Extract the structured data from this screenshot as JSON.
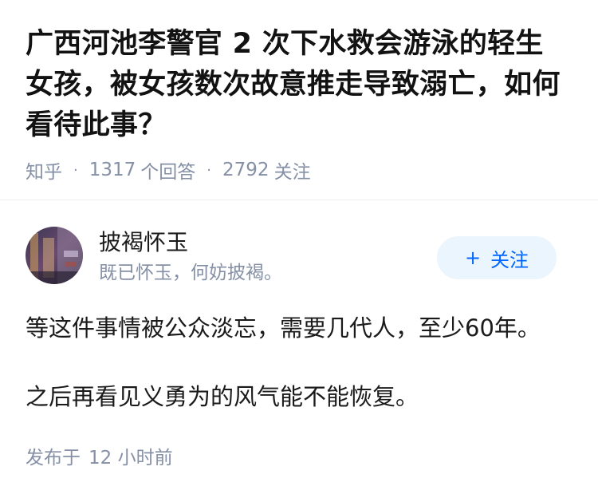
{
  "question": {
    "title": "广西河池李警官 2 次下水救会游泳的轻生女孩，被女孩数次故意推走导致溺亡，如何看待此事？",
    "source": "知乎",
    "answers_count": "1317",
    "answers_label": "个回答",
    "follow_count": "2792",
    "follow_label": "关注"
  },
  "answer": {
    "author_name": "披褐怀玉",
    "author_bio": "既已怀玉，何妨披褐。",
    "follow_button_label": "关注",
    "follow_button_icon": "plus-icon",
    "paragraphs": [
      "等这件事情被公众淡忘，需要几代人，至少60年。",
      "之后再看见义勇为的风气能不能恢复。"
    ],
    "publish_label": "发布于",
    "publish_time": "12 小时前"
  },
  "colors": {
    "text": "#1a1a1a",
    "meta": "#8590a6",
    "accent": "#0066ff",
    "button_bg": "#ebf5fd"
  }
}
